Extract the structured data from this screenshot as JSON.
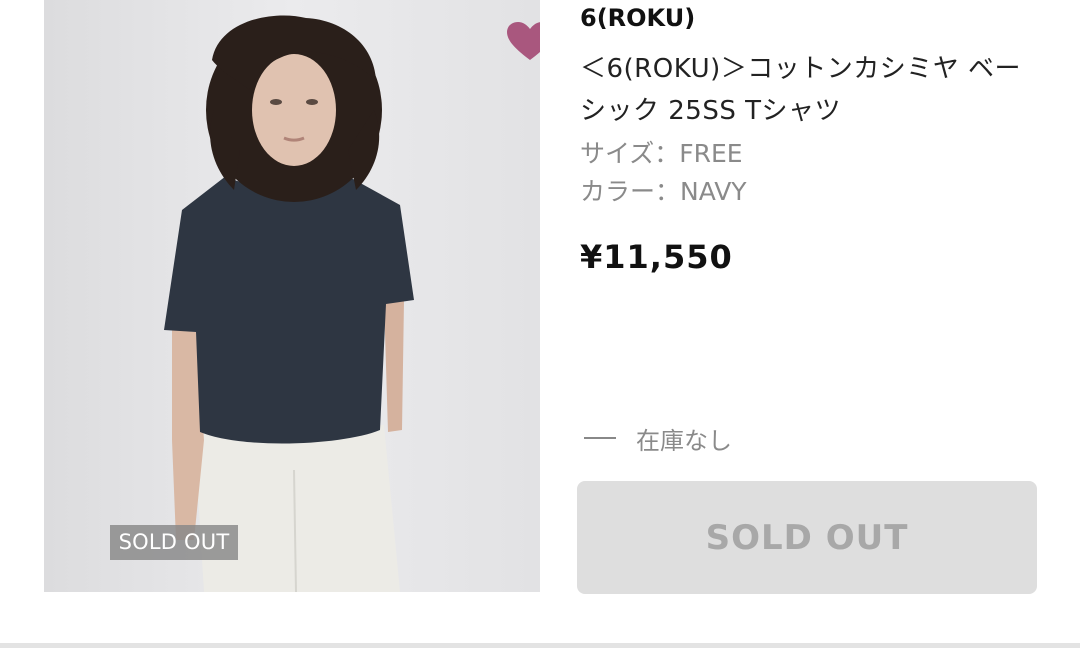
{
  "product": {
    "brand": "6(ROKU)",
    "name": "＜6(ROKU)＞コットンカシミヤ ベーシック 25SS Tシャツ",
    "size_label": "サイズ：FREE",
    "color_label": "カラー：NAVY",
    "price": "¥11,550",
    "stock_status": "在庫なし",
    "image_badge": "SOLD OUT",
    "button_label": "SOLD OUT"
  },
  "icons": {
    "favorite": "heart-icon",
    "stock_indicator": "dash-icon"
  },
  "colors": {
    "heart": "#a9577e",
    "shirt": "#2e3642",
    "button_bg": "#dedede",
    "button_text": "#a8a8a8"
  }
}
